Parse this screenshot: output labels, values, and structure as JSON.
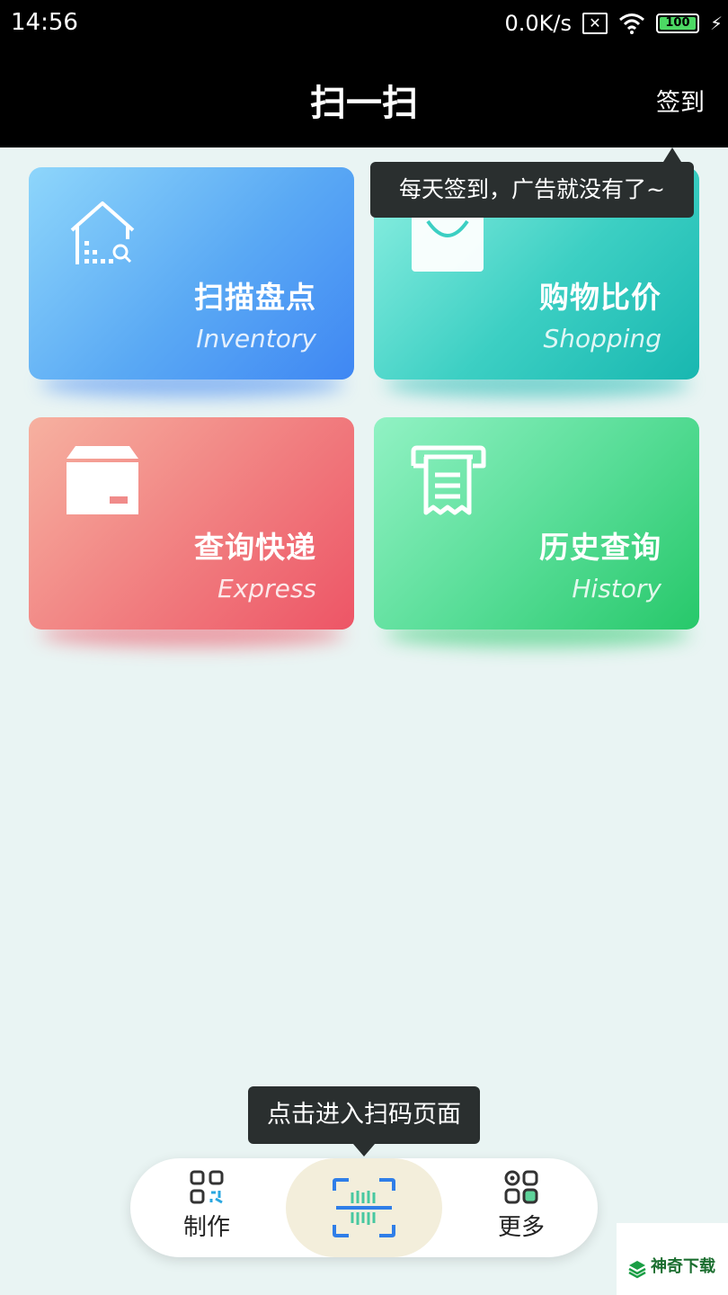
{
  "status_bar": {
    "time": "14:56",
    "net_speed": "0.0K/s",
    "battery": "100"
  },
  "header": {
    "title": "扫一扫",
    "signin_label": "签到"
  },
  "tooltip_signin": "每天签到，广告就没有了~",
  "cards": [
    {
      "title": "扫描盘点",
      "subtitle": "Inventory",
      "icon": "house-search-icon",
      "color": "#3f87f3"
    },
    {
      "title": "购物比价",
      "subtitle": "Shopping",
      "icon": "shopping-bag-icon",
      "color": "#18b7b0"
    },
    {
      "title": "查询快递",
      "subtitle": "Express",
      "icon": "package-box-icon",
      "color": "#ed5566"
    },
    {
      "title": "历史查询",
      "subtitle": "History",
      "icon": "receipt-icon",
      "color": "#27c86a"
    }
  ],
  "tooltip_scan": "点击进入扫码页面",
  "bottom_nav": {
    "make_label": "制作",
    "more_label": "更多"
  },
  "watermark": "神奇下载"
}
